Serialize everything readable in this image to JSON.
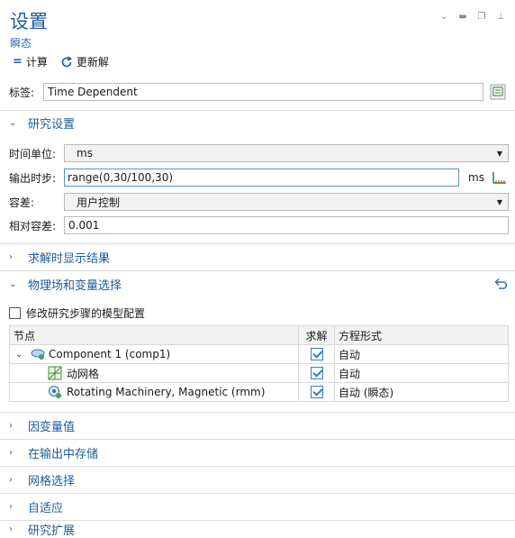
{
  "header": {
    "title": "设置",
    "subtitle": "瞬态"
  },
  "toolbar": {
    "compute_label": "计算",
    "update_label": "更新解"
  },
  "label_field": {
    "label": "标签:",
    "value": "Time Dependent"
  },
  "study_settings": {
    "section_label": "研究设置",
    "time_unit": {
      "label": "时间单位:",
      "value": "ms"
    },
    "output_times": {
      "label": "输出时步:",
      "value": "range(0,30/100,30)",
      "unit": "ms"
    },
    "tolerance": {
      "label": "容差:",
      "value": "用户控制"
    },
    "relative_tolerance": {
      "label": "相对容差:",
      "value": "0.001"
    }
  },
  "sections": {
    "results_while_solving": "求解时显示结果",
    "physics_selection": "物理场和变量选择",
    "dependent_values": "因变量值",
    "store_in_output": "在输出中存储",
    "mesh_selection": "网格选择",
    "adaptation": "自适应",
    "study_extensions": "研究扩展"
  },
  "modify_model_config": {
    "label": "修改研究步骤的模型配置",
    "checked": false
  },
  "table": {
    "headers": [
      "节点",
      "求解",
      "方程形式"
    ],
    "rows": [
      {
        "node": "Component 1 (comp1)",
        "solve": true,
        "form": "自动"
      },
      {
        "node": "动网格",
        "solve": true,
        "form": "自动"
      },
      {
        "node": "Rotating Machinery, Magnetic (rmm)",
        "solve": true,
        "form": "自动 (瞬态)"
      }
    ]
  },
  "colors": {
    "accent": "#1f5c99",
    "check": "#3a7bbf"
  }
}
